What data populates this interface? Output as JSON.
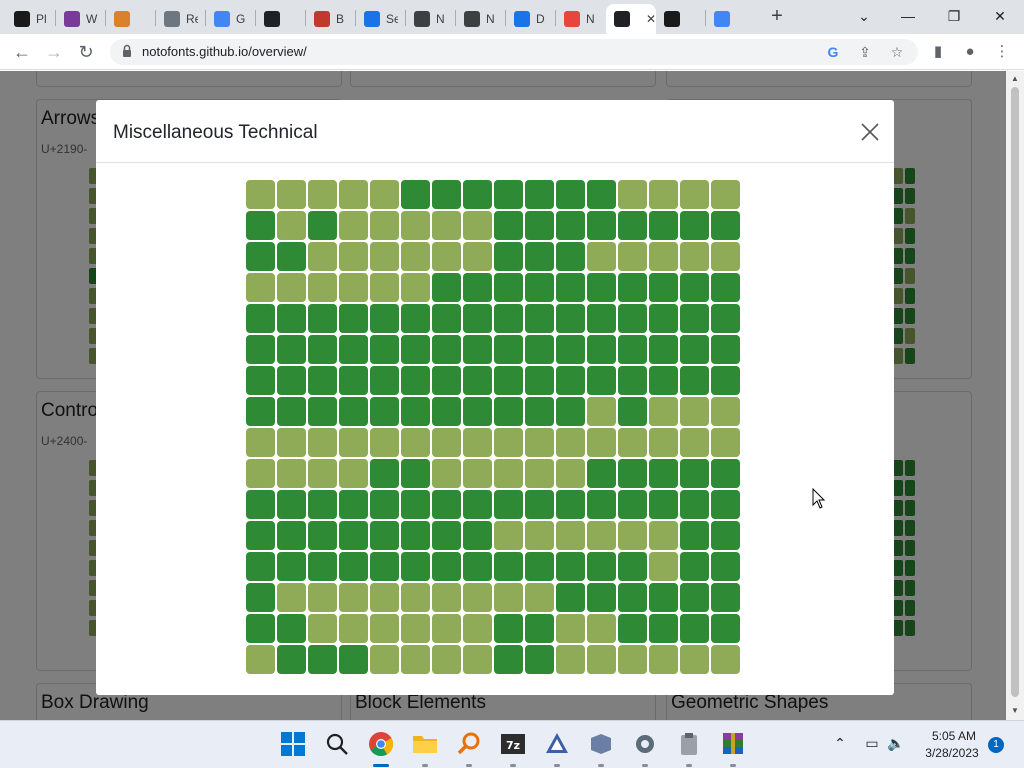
{
  "browser": {
    "tabs": [
      {
        "title": "Pl",
        "favicon_color": "#1a1a1a",
        "left": 0
      },
      {
        "title": "W",
        "favicon_color": "#7a3a9a"
      },
      {
        "title": "",
        "favicon_color": "#d9822b"
      },
      {
        "title": "Re",
        "favicon_color": "#6e7681"
      },
      {
        "title": "G",
        "favicon_color": "#4285f4"
      },
      {
        "title": "",
        "favicon_color": "#202124"
      },
      {
        "title": "B",
        "favicon_color": "#c0392b"
      },
      {
        "title": "Se",
        "favicon_color": "#1a73e8"
      },
      {
        "title": "N",
        "favicon_color": "#3c4043"
      },
      {
        "title": "N",
        "favicon_color": "#3c4043"
      },
      {
        "title": "D",
        "favicon_color": "#1a73e8"
      },
      {
        "title": "N",
        "favicon_color": "#e8453c"
      },
      {
        "title": "",
        "favicon_color": "#202124",
        "active": true
      },
      {
        "title": "",
        "favicon_color": "#1a1a1a"
      },
      {
        "title": "",
        "favicon_color": "#4285f4"
      }
    ],
    "url": "notofonts.github.io/overview/"
  },
  "page": {
    "cards": [
      {
        "name": "Arrows",
        "range": "U+2190-"
      },
      {
        "name": "Control Pictures",
        "range": "U+2400-"
      },
      {
        "name": "Box Drawing",
        "range": ""
      },
      {
        "name": "Block Elements",
        "range": ""
      },
      {
        "name": "Geometric Shapes",
        "range": ""
      }
    ]
  },
  "modal": {
    "title": "Miscellaneous Technical",
    "colors": {
      "light": "#8fab58",
      "dark": "#2e8a35"
    },
    "grid_rows": [
      "LLLLLDDDDDDDLLLL",
      "DLDLLLLLDDDDDDDD",
      "DDLLLLLLDDDLLLLL",
      "LLLLLLDDDDDDDDDD",
      "DDDDDDDDDDDDDDDD",
      "DDDDDDDDDDDDDDDD",
      "DDDDDDDDDDDDDDDD",
      "DDDDDDDDDDDLDLLL",
      "LLLLLLLLLLLLLLLL",
      "LLLLDDLLLLLDDDDD",
      "DDDDDDDDDDDDDDDD",
      "DDDDDDDDLLLLLLDD",
      "DDDDDDDDDDDDDLDD",
      "DLLLLLLLLLDDDDDD",
      "DDLLLLLLDDLLDDDD",
      "LDDDLLLLDDLLLLLL"
    ]
  },
  "taskbar": {
    "time": "5:05 AM",
    "date": "3/28/2023",
    "notification_count": "1"
  }
}
